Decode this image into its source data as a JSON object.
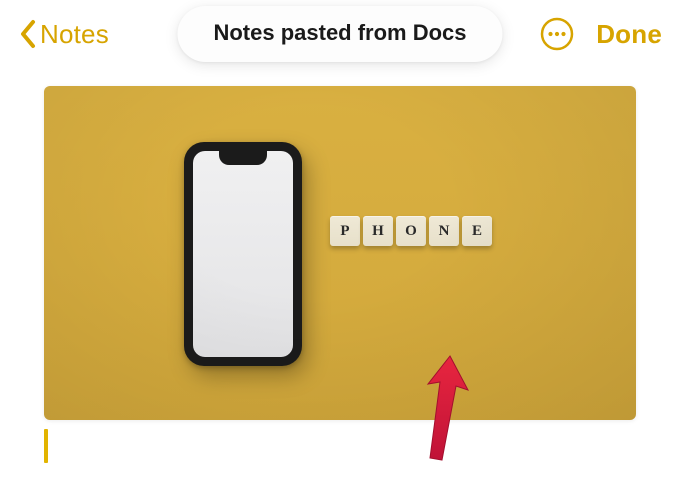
{
  "header": {
    "back_label": "Notes",
    "title": "Notes pasted from Docs",
    "done_label": "Done"
  },
  "colors": {
    "accent": "#d7a400",
    "image_bg": "#d5ac3e",
    "arrow": "#e21d3f"
  },
  "image": {
    "tile_letters": [
      "P",
      "H",
      "O",
      "N",
      "E"
    ],
    "subject": "smartphone mockup on yellow surface"
  }
}
